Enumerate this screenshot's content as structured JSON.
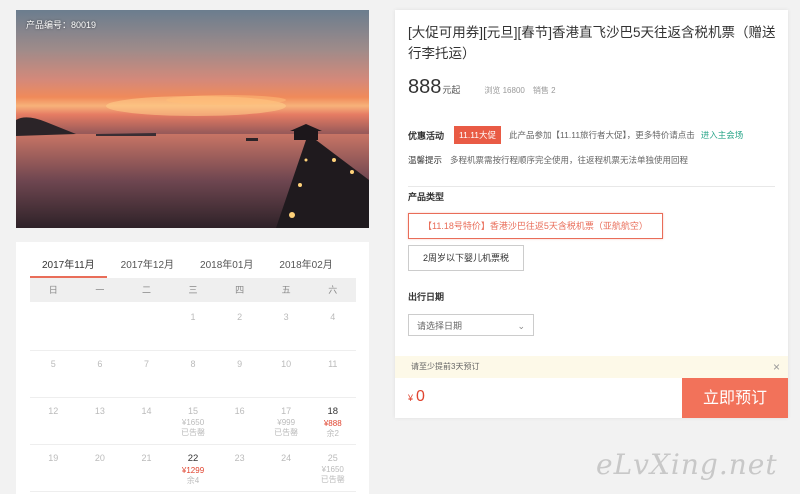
{
  "product": {
    "code_label": "产品编号：80019",
    "title": "[大促可用券][元旦][春节]香港直飞沙巴5天往返含税机票（赠送行李托运）",
    "price": "888",
    "price_unit": "元起",
    "views": "浏览 16800",
    "sales": "销售 2"
  },
  "promo": {
    "label": "优惠活动",
    "badge": "11.11大促",
    "text": "此产品参加【11.11旅行者大促】，更多特价请点击",
    "link": "进入主会场"
  },
  "tip": {
    "label": "温馨提示",
    "text": "多程机票需按行程顺序完全使用，往返程机票无法单独使用回程"
  },
  "product_type": {
    "label": "产品类型",
    "options": [
      "【11.18号特价】香港沙巴往返5天含税机票（亚航航空）",
      "2周岁以下婴儿机票税"
    ]
  },
  "departure": {
    "label": "出行日期",
    "placeholder": "请选择日期"
  },
  "notice": "请至少提前3天预订",
  "total": {
    "symbol": "¥",
    "value": "0"
  },
  "book_button": "立即预订",
  "calendar": {
    "tabs": [
      "2017年11月",
      "2017年12月",
      "2018年01月",
      "2018年02月"
    ],
    "weekdays": [
      "日",
      "一",
      "二",
      "三",
      "四",
      "五",
      "六"
    ],
    "rows": [
      [
        {
          "d": ""
        },
        {
          "d": ""
        },
        {
          "d": ""
        },
        {
          "d": "1"
        },
        {
          "d": "2"
        },
        {
          "d": "3"
        },
        {
          "d": "4"
        }
      ],
      [
        {
          "d": "5"
        },
        {
          "d": "6"
        },
        {
          "d": "7"
        },
        {
          "d": "8"
        },
        {
          "d": "9"
        },
        {
          "d": "10"
        },
        {
          "d": "11"
        }
      ],
      [
        {
          "d": "12"
        },
        {
          "d": "13"
        },
        {
          "d": "14"
        },
        {
          "d": "15",
          "p": "¥1650",
          "s": "已告罄"
        },
        {
          "d": "16"
        },
        {
          "d": "17",
          "p": "¥999",
          "s": "已告罄"
        },
        {
          "d": "18",
          "p": "¥888",
          "s": "余2",
          "active": true
        }
      ],
      [
        {
          "d": "19"
        },
        {
          "d": "20"
        },
        {
          "d": "21"
        },
        {
          "d": "22",
          "p": "¥1299",
          "s": "余4",
          "active": true
        },
        {
          "d": "23"
        },
        {
          "d": "24"
        },
        {
          "d": "25",
          "p": "¥1650",
          "s": "已告罄"
        }
      ]
    ]
  },
  "watermark": "eLvXing.net",
  "colors": {
    "accent": "#f2725a",
    "badge": "#e95b45",
    "link": "#2aa68a",
    "price_red": "#e0442f"
  }
}
